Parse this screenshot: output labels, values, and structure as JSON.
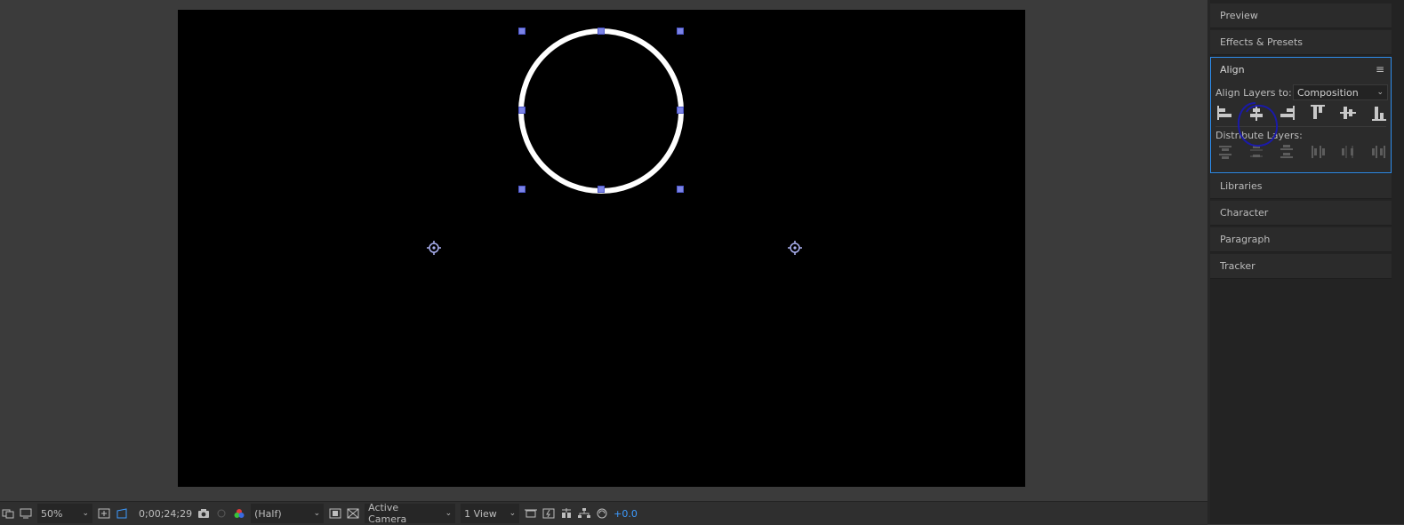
{
  "viewer": {
    "bottom_bar": {
      "zoom": "50%",
      "timecode": "0;00;24;29",
      "resolution": "(Half)",
      "camera": "Active Camera",
      "views": "1 View",
      "exposure": "+0.0"
    }
  },
  "panels": {
    "preview": "Preview",
    "effects": "Effects & Presets",
    "align": {
      "title": "Align",
      "align_to_label": "Align Layers to:",
      "align_to_value": "Composition",
      "distribute_label": "Distribute Layers:"
    },
    "libraries": "Libraries",
    "character": "Character",
    "paragraph": "Paragraph",
    "tracker": "Tracker"
  },
  "colors": {
    "accent": "#2d8ceb",
    "handle": "#7b83e6",
    "annotation": "#1a1aa8"
  }
}
